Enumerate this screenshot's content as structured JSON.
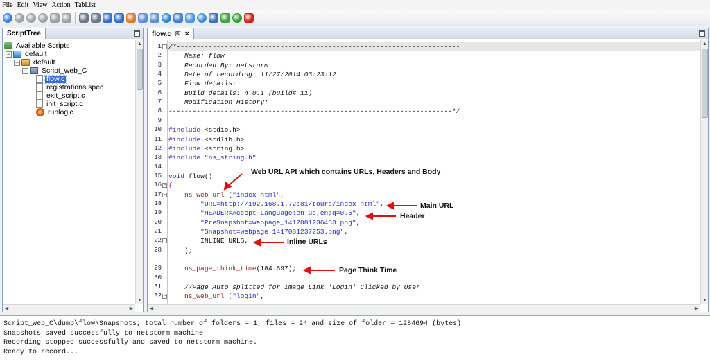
{
  "menu": [
    "File",
    "Edit",
    "View",
    "Action",
    "TabList"
  ],
  "toolbar_icons": [
    {
      "name": "run-icon",
      "color": "#2b7de9",
      "shape": "round"
    },
    {
      "name": "stop-icon",
      "color": "#9aa0a6",
      "shape": "round"
    },
    {
      "name": "cancel-icon",
      "color": "#9aa0a6",
      "shape": "round"
    },
    {
      "name": "pause-icon",
      "color": "#9aa0a6",
      "shape": "round"
    },
    {
      "name": "step-icon",
      "color": "#9aa0a6",
      "shape": "square"
    },
    {
      "name": "comment-icon",
      "color": "#9aa0a6",
      "shape": "square"
    },
    {
      "name": "sep",
      "color": "",
      "shape": "sep"
    },
    {
      "name": "new-icon",
      "color": "#6a7788",
      "shape": "square"
    },
    {
      "name": "copy-icon",
      "color": "#6a7788",
      "shape": "square"
    },
    {
      "name": "download-icon",
      "color": "#2f6fd0",
      "shape": "square"
    },
    {
      "name": "upload-icon",
      "color": "#2f6fd0",
      "shape": "square"
    },
    {
      "name": "record-icon",
      "color": "#e07a2a",
      "shape": "square"
    },
    {
      "name": "search-icon",
      "color": "#5b8fd6",
      "shape": "square"
    },
    {
      "name": "replace-icon",
      "color": "#5b8fd6",
      "shape": "square"
    },
    {
      "name": "settings-icon",
      "color": "#2b82d9",
      "shape": "round"
    },
    {
      "name": "document-icon",
      "color": "#3f7fd6",
      "shape": "square"
    },
    {
      "name": "window-icon",
      "color": "#4c9be0",
      "shape": "square"
    },
    {
      "name": "refresh-icon",
      "color": "#3a8fd8",
      "shape": "round"
    },
    {
      "name": "monitor-icon",
      "color": "#3c6fb8",
      "shape": "square"
    },
    {
      "name": "check-icon",
      "color": "#3aa53a",
      "shape": "square"
    },
    {
      "name": "start-icon",
      "color": "#2aa12a",
      "shape": "round"
    },
    {
      "name": "exit-icon",
      "color": "#d42020",
      "shape": "square"
    }
  ],
  "left_panel": {
    "tab": "ScriptTree",
    "tree": [
      {
        "label": "Available Scripts",
        "icon": "scripts-icon",
        "expander": ""
      },
      {
        "label": "default",
        "icon": "project-icon",
        "expander": "−"
      },
      {
        "label": "default",
        "icon": "folder-icon",
        "expander": "−"
      },
      {
        "label": "Script_web_C",
        "icon": "script-icon",
        "expander": "−"
      },
      {
        "label": "flow.c",
        "icon": "file-icon",
        "expander": "",
        "selected": true
      },
      {
        "label": "registrations.spec",
        "icon": "file-icon",
        "expander": ""
      },
      {
        "label": "exit_script.c",
        "icon": "file-icon",
        "expander": ""
      },
      {
        "label": "init_script.c",
        "icon": "file-icon",
        "expander": ""
      },
      {
        "label": "runlogic",
        "icon": "runlogic-icon",
        "expander": ""
      }
    ]
  },
  "editor": {
    "tab": "flow.c",
    "lines": [
      {
        "n": "1",
        "fold": "−",
        "segs": [
          {
            "c": "cmt",
            "t": "/*-----------------------------------------------------------------------"
          }
        ]
      },
      {
        "n": "2",
        "fold": "",
        "segs": [
          {
            "c": "cmt",
            "t": "    Name: flow"
          }
        ]
      },
      {
        "n": "3",
        "fold": "",
        "segs": [
          {
            "c": "cmt",
            "t": "    Recorded By: netstorm"
          }
        ]
      },
      {
        "n": "4",
        "fold": "",
        "segs": [
          {
            "c": "cmt",
            "t": "    Date of recording: 11/27/2014 03:23:12"
          }
        ]
      },
      {
        "n": "5",
        "fold": "",
        "segs": [
          {
            "c": "cmt",
            "t": "    Flow details:"
          }
        ]
      },
      {
        "n": "6",
        "fold": "",
        "segs": [
          {
            "c": "cmt",
            "t": "    Build details: 4.0.1 (build# 11)"
          }
        ]
      },
      {
        "n": "7",
        "fold": "",
        "segs": [
          {
            "c": "cmt",
            "t": "    Modification History:"
          }
        ]
      },
      {
        "n": "8",
        "fold": "",
        "segs": [
          {
            "c": "cmt",
            "t": "-----------------------------------------------------------------------*/"
          }
        ]
      },
      {
        "n": "9",
        "fold": "",
        "segs": [
          {
            "c": "plain",
            "t": ""
          }
        ]
      },
      {
        "n": "10",
        "fold": "",
        "segs": [
          {
            "c": "pp",
            "t": "#include "
          },
          {
            "c": "plain",
            "t": "<stdio.h>"
          }
        ]
      },
      {
        "n": "11",
        "fold": "",
        "segs": [
          {
            "c": "pp",
            "t": "#include "
          },
          {
            "c": "plain",
            "t": "<stdlib.h>"
          }
        ]
      },
      {
        "n": "12",
        "fold": "",
        "segs": [
          {
            "c": "pp",
            "t": "#include "
          },
          {
            "c": "plain",
            "t": "<string.h>"
          }
        ]
      },
      {
        "n": "13",
        "fold": "",
        "segs": [
          {
            "c": "pp",
            "t": "#include "
          },
          {
            "c": "str",
            "t": "\"ns_string.h\""
          }
        ]
      },
      {
        "n": "14",
        "fold": "",
        "segs": [
          {
            "c": "plain",
            "t": ""
          }
        ]
      },
      {
        "n": "15",
        "fold": "",
        "segs": [
          {
            "c": "kw",
            "t": "void "
          },
          {
            "c": "plain",
            "t": "flow()"
          }
        ]
      },
      {
        "n": "16",
        "fold": "−",
        "segs": [
          {
            "c": "brace",
            "t": "{"
          }
        ]
      },
      {
        "n": "17",
        "fold": "−",
        "segs": [
          {
            "c": "fn",
            "t": "    ns_web_url "
          },
          {
            "c": "plain",
            "t": "("
          },
          {
            "c": "str",
            "t": "\"index_html\""
          },
          {
            "c": "plain",
            "t": ","
          }
        ]
      },
      {
        "n": "18",
        "fold": "",
        "segs": [
          {
            "c": "str",
            "t": "        \"URL=http://192.168.1.72:81/tours/index.html\""
          },
          {
            "c": "plain",
            "t": ","
          }
        ]
      },
      {
        "n": "19",
        "fold": "",
        "segs": [
          {
            "c": "str",
            "t": "        \"HEADER=Accept-Language:en-us,en;q=0.5\""
          },
          {
            "c": "plain",
            "t": ","
          }
        ]
      },
      {
        "n": "20",
        "fold": "",
        "segs": [
          {
            "c": "str",
            "t": "        \"PreSnapshot=webpage_1417081236433.png\""
          },
          {
            "c": "plain",
            "t": ","
          }
        ]
      },
      {
        "n": "21",
        "fold": "",
        "segs": [
          {
            "c": "str",
            "t": "        \"Snapshot=webpage_1417081237253.png\""
          },
          {
            "c": "plain",
            "t": ","
          }
        ]
      },
      {
        "n": "22",
        "fold": "−",
        "segs": [
          {
            "c": "plain",
            "t": "        INLINE_URLS,"
          }
        ]
      },
      {
        "n": "28",
        "fold": "",
        "segs": [
          {
            "c": "plain",
            "t": "    );"
          }
        ]
      },
      {
        "n": "",
        "fold": "",
        "segs": [
          {
            "c": "plain",
            "t": ""
          }
        ]
      },
      {
        "n": "29",
        "fold": "",
        "segs": [
          {
            "c": "fn",
            "t": "    ns_page_think_time"
          },
          {
            "c": "plain",
            "t": "(184.697);"
          }
        ]
      },
      {
        "n": "30",
        "fold": "",
        "segs": [
          {
            "c": "plain",
            "t": ""
          }
        ]
      },
      {
        "n": "31",
        "fold": "",
        "segs": [
          {
            "c": "cmt",
            "t": "    //Page Auto splitted for Image Link 'Login' Clicked by User"
          }
        ]
      },
      {
        "n": "32",
        "fold": "−",
        "segs": [
          {
            "c": "fn",
            "t": "    ns_web_url "
          },
          {
            "c": "plain",
            "t": "("
          },
          {
            "c": "str",
            "t": "\"login\""
          },
          {
            "c": "plain",
            "t": ","
          }
        ]
      }
    ],
    "annotations": {
      "web_url_api": "Web URL API which contains URLs, Headers and Body",
      "main_url": "Main URL",
      "header": "Header",
      "inline_urls": "Inline URLs",
      "page_think_time": "Page Think Time"
    }
  },
  "console": [
    "Script_web_C\\dump\\flow\\Snapshots, total number of folders = 1, files = 24 and size of folder = 1284694 (bytes)",
    "Snapshots saved successfully to netstorm machine",
    "Recording stopped successfully and saved to netstorm machine.",
    "Ready to record..."
  ]
}
